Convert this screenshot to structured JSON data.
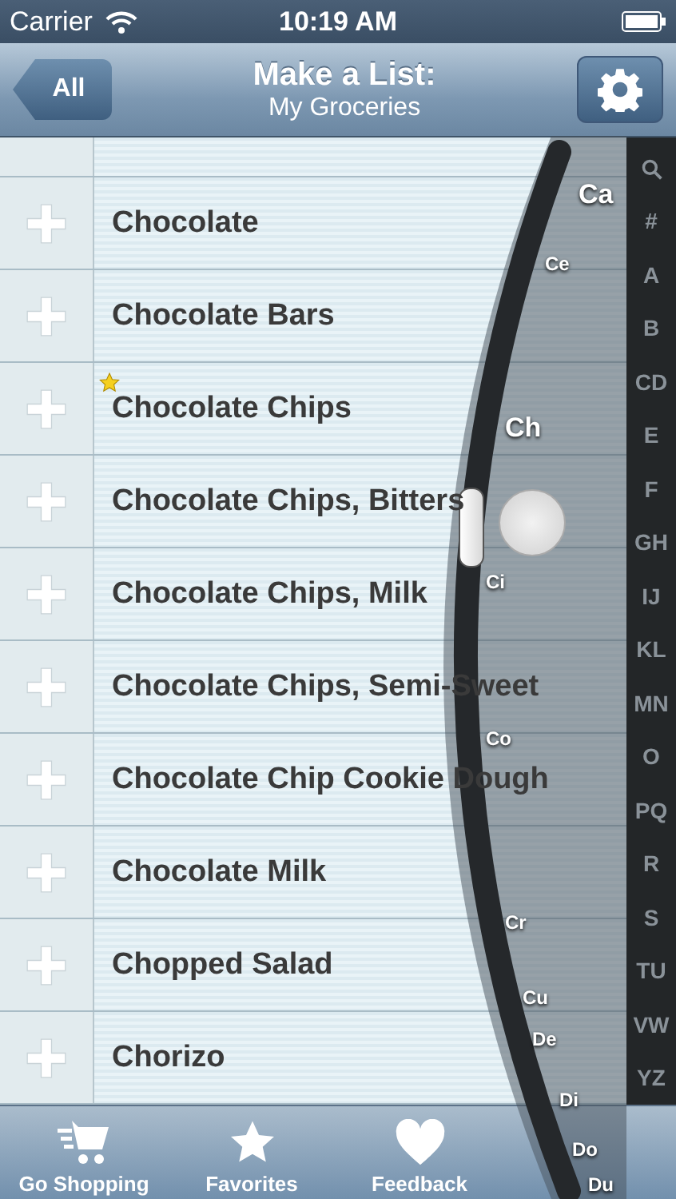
{
  "status_bar": {
    "carrier": "Carrier",
    "time": "10:19 AM"
  },
  "nav_bar": {
    "back_button": "All",
    "title": "Make a List:",
    "subtitle": "My Groceries"
  },
  "items": [
    {
      "name": "Chocolate",
      "favorite": false
    },
    {
      "name": "Chocolate Bars",
      "favorite": false
    },
    {
      "name": "Chocolate Chips",
      "favorite": true
    },
    {
      "name": "Chocolate Chips, Bitters",
      "favorite": false
    },
    {
      "name": "Chocolate Chips, Milk",
      "favorite": false
    },
    {
      "name": "Chocolate Chips, Semi-Sweet",
      "favorite": false
    },
    {
      "name": "Chocolate Chip Cookie Dough",
      "favorite": false
    },
    {
      "name": "Chocolate Milk",
      "favorite": false
    },
    {
      "name": "Chopped Salad",
      "favorite": false
    },
    {
      "name": "Chorizo",
      "favorite": false
    }
  ],
  "scrubber_labels": [
    "Ca",
    "Ce",
    "Ch",
    "Ci",
    "Co",
    "Cr",
    "Cu",
    "De",
    "Di",
    "Do",
    "Du"
  ],
  "index_letters": [
    "#",
    "A",
    "B",
    "CD",
    "E",
    "F",
    "GH",
    "IJ",
    "KL",
    "MN",
    "O",
    "PQ",
    "R",
    "S",
    "TU",
    "VW",
    "YZ"
  ],
  "tabs": [
    {
      "kind": "cart",
      "label": "Go Shopping"
    },
    {
      "kind": "star",
      "label": "Favorites"
    },
    {
      "kind": "heart",
      "label": "Feedback"
    }
  ]
}
